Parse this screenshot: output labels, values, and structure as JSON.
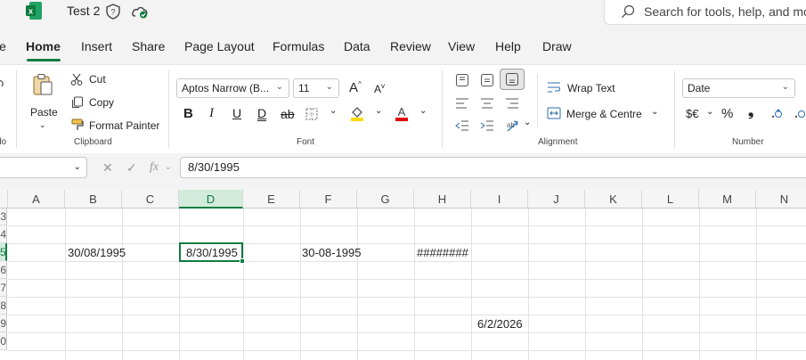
{
  "titlebar": {
    "doc_title": "Test 2",
    "search_placeholder": "Search for tools, help, and mo",
    "icons": [
      "excel-logo-icon",
      "sensitivity-shield-icon",
      "cloud-saved-icon",
      "search-icon"
    ]
  },
  "tabs": [
    "le",
    "Home",
    "Insert",
    "Share",
    "Page Layout",
    "Formulas",
    "Data",
    "Review",
    "View",
    "Help",
    "Draw"
  ],
  "active_tab": "Home",
  "ribbon": {
    "clipboard": {
      "paste": "Paste",
      "cut": "Cut",
      "copy": "Copy",
      "format_painter": "Format Painter",
      "label": "Clipboard",
      "undo_label": "do"
    },
    "font": {
      "font_name": "Aptos Narrow (B...",
      "font_size": "11",
      "label": "Font"
    },
    "alignment": {
      "wrap_text": "Wrap Text",
      "merge_centre": "Merge & Centre",
      "label": "Alignment"
    },
    "number": {
      "format": "Date",
      "currency": "$€",
      "percent": "%",
      "label": "Number"
    }
  },
  "formula_bar": {
    "value": "8/30/1995",
    "fx": "fx"
  },
  "grid": {
    "columns": [
      "A",
      "B",
      "C",
      "D",
      "E",
      "F",
      "G",
      "H",
      "I",
      "J",
      "K",
      "L",
      "M",
      "N"
    ],
    "rows": [
      "3",
      "4",
      "5",
      "6",
      "7",
      "8",
      "9",
      "0"
    ],
    "selected_column": "D",
    "selected_row": "5",
    "cells": {
      "B5": "30/08/1995",
      "D5": "8/30/1995",
      "F5": "30-08-1995",
      "H5": "########",
      "I9": "6/2/2026"
    }
  },
  "colors": {
    "accent": "#107c41",
    "font_color_bar": "#e00000",
    "highlight_bar": "#ffd800"
  }
}
